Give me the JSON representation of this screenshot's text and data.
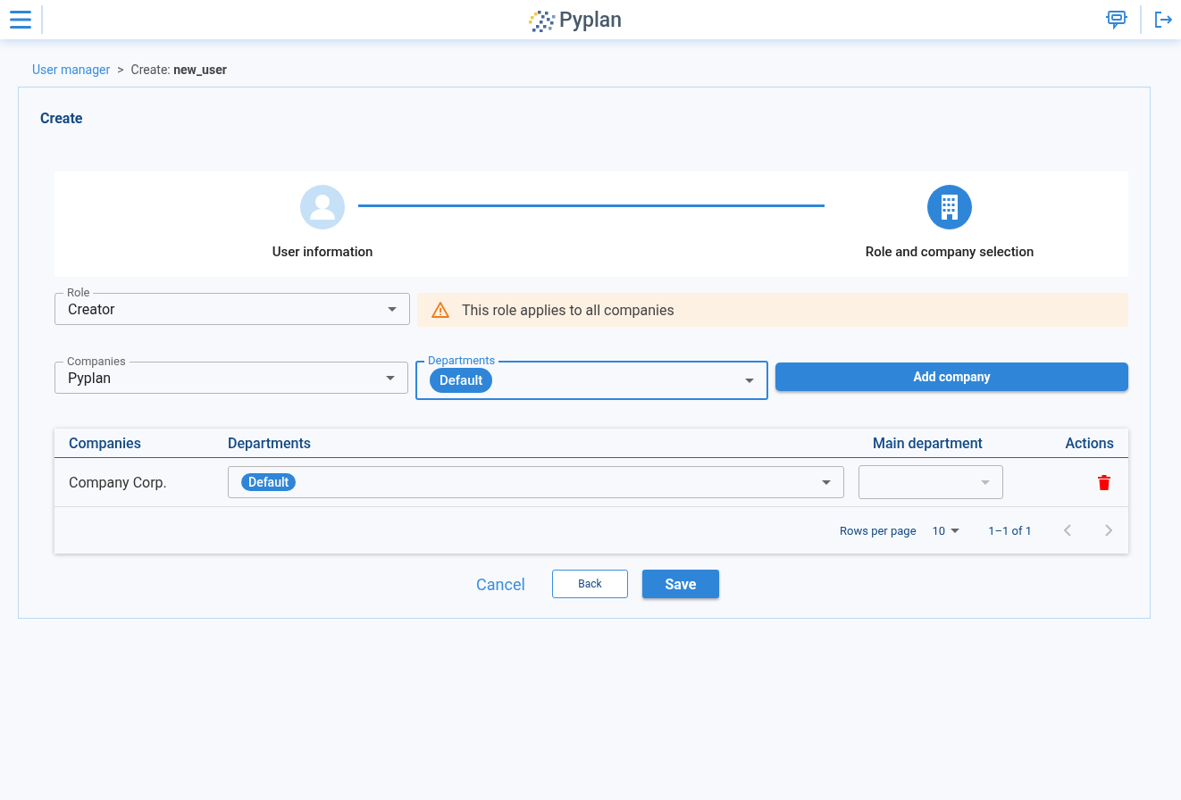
{
  "header": {
    "logo_text": "Pyplan"
  },
  "breadcrumb": {
    "parent": "User manager",
    "separator": ">",
    "current_label": "Create:",
    "current_value": "new_user"
  },
  "panel": {
    "title": "Create"
  },
  "steps": [
    {
      "label": "User information",
      "selected": false,
      "kind": "user"
    },
    {
      "label": "Role and company selection",
      "selected": true,
      "kind": "building"
    }
  ],
  "role_field": {
    "label": "Role",
    "value": "Creator"
  },
  "alert": {
    "text": "This role applies to all companies"
  },
  "companies_field": {
    "label": "Companies",
    "value": "Pyplan",
    "focused": false
  },
  "departments_field": {
    "label": "Departments",
    "chips": [
      "Default"
    ],
    "focused": true
  },
  "add_button": "Add company",
  "table": {
    "columns": [
      "Companies",
      "Departments",
      "Main department",
      "Actions"
    ],
    "rows": [
      {
        "company": "Company Corp.",
        "departments": [
          "Default"
        ],
        "main_department": ""
      }
    ],
    "rows_per_page_label": "Rows per page",
    "rows_per_page": "10",
    "range": "1–1 of 1"
  },
  "buttons": {
    "cancel": "Cancel",
    "back": "Back",
    "save": "Save"
  }
}
